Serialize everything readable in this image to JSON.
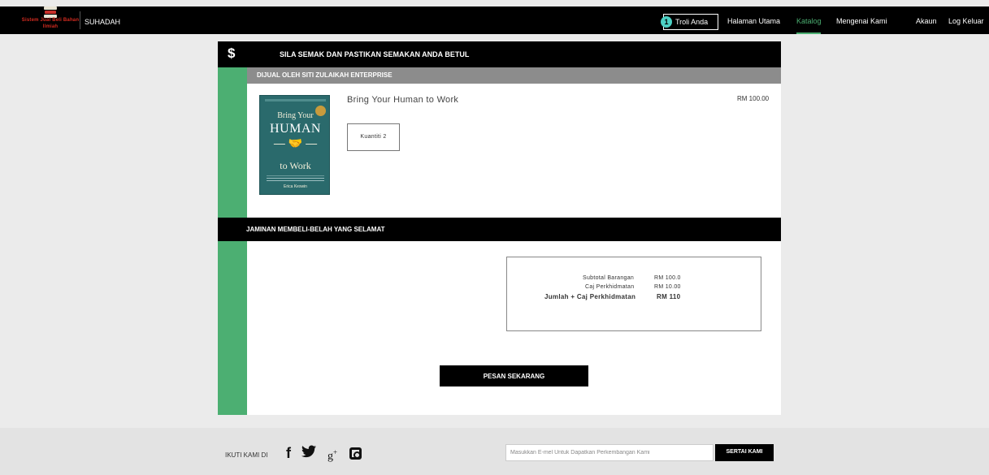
{
  "header": {
    "logo_text": "Sistem Jual Beli Bahan Ilmiah",
    "user_name": "SUHADAH",
    "cart": {
      "count": "1",
      "label": "Troli Anda"
    },
    "nav": [
      "Halaman Utama",
      "Katalog",
      "Mengenai Kami",
      "Akaun",
      "Log Keluar"
    ],
    "active_nav": "Katalog",
    "accent_color": "#4caf72"
  },
  "checkout": {
    "currency_icon": "$",
    "title": "SILA SEMAK DAN PASTIKAN SEMAKAN ANDA BETUL",
    "seller": "DIJUAL OLEH SITI ZULAIKAH ENTERPRISE",
    "item": {
      "title": "Bring Your Human to Work",
      "quantity_label": "Kuantiti 2",
      "price": "RM 100.00",
      "cover": {
        "line1": "Bring Your",
        "line2": "HUMAN",
        "line3": "to Work",
        "author": "Erica Keswin",
        "color": "#2a6a6c"
      }
    },
    "safe_title": "JAMINAN MEMBELI-BELAH YANG SELAMAT",
    "summary": {
      "subtotal_label": "Subtotal Barangan",
      "subtotal_value": "RM 100.0",
      "service_label": "Caj Perkhidmatan",
      "service_value": "RM 10.00",
      "total_label": "Jumlah + Caj Perkhidmatan",
      "total_value": "RM 110"
    },
    "order_button": "PESAN SEKARANG"
  },
  "footer": {
    "follow_label": "IKUTI KAMI DI",
    "social_icons": [
      "facebook-icon",
      "twitter-icon",
      "google-plus-icon",
      "instagram-icon"
    ],
    "email_placeholder": "Masukkan E-mel Untuk Dapatkan Perkembangan Kami",
    "subscribe_label": "SERTAI KAMI"
  }
}
